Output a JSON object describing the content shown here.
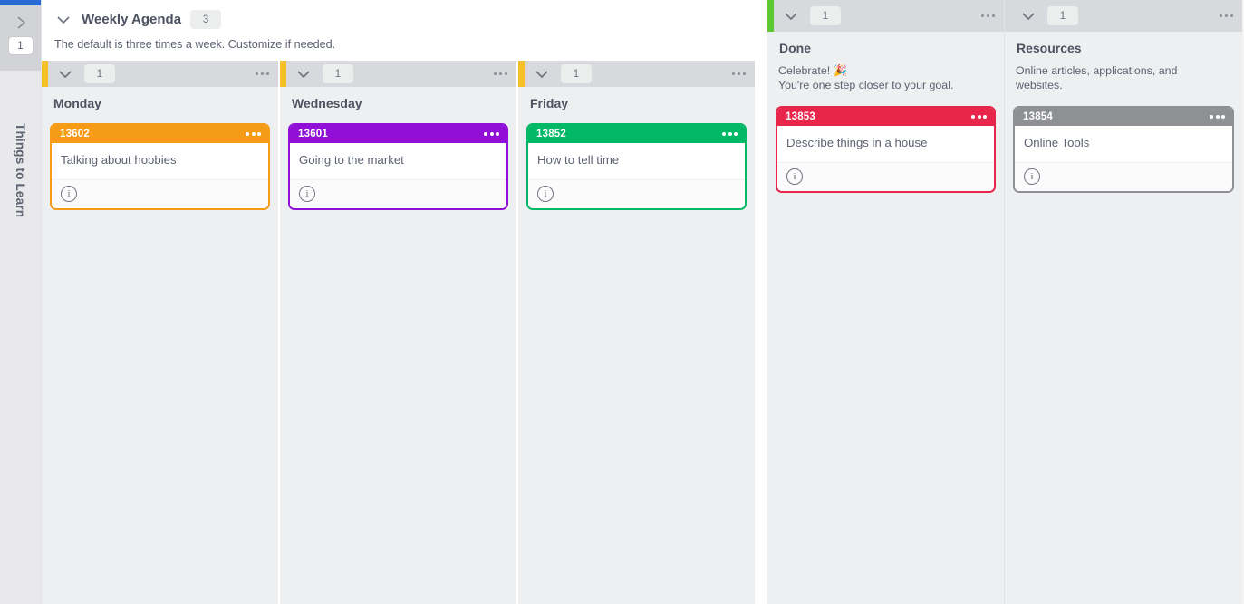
{
  "sidebar": {
    "expand_badge": "1",
    "board_title": "Things to Learn",
    "accent_color": "#2a6ad6"
  },
  "lane": {
    "title": "Weekly Agenda",
    "count": "3",
    "description": "The default is three times a week. Customize if needed.",
    "accent_color": "#f5c025",
    "columns": [
      {
        "name": "Monday",
        "count": "1",
        "accent_color": "#f5c025",
        "description": "",
        "cards": [
          {
            "id": "13602",
            "title": "Talking about hobbies",
            "color": "#f59b16"
          }
        ]
      },
      {
        "name": "Wednesday",
        "count": "1",
        "accent_color": "#f5c025",
        "description": "",
        "cards": [
          {
            "id": "13601",
            "title": "Going to the market",
            "color": "#9010d8"
          }
        ]
      },
      {
        "name": "Friday",
        "count": "1",
        "accent_color": "#f5c025",
        "description": "",
        "cards": [
          {
            "id": "13852",
            "title": "How to tell time",
            "color": "#00b865"
          }
        ]
      }
    ]
  },
  "columns": [
    {
      "name": "Done",
      "count": "1",
      "accent_color": "#5cc832",
      "description": "Celebrate! 🎉\nYou're one step closer to your goal.",
      "cards": [
        {
          "id": "13853",
          "title": "Describe things in a house",
          "color": "#e8254a"
        }
      ]
    },
    {
      "name": "Resources",
      "count": "1",
      "accent_color": "",
      "description": "Online articles, applications, and websites.",
      "cards": [
        {
          "id": "13854",
          "title": "Online Tools",
          "color": "#8e9094"
        }
      ]
    }
  ],
  "icons": {
    "collapse_chevron": "chevron-down",
    "expand_chevron": "chevron-right",
    "overflow": "ellipsis",
    "info": "i"
  }
}
